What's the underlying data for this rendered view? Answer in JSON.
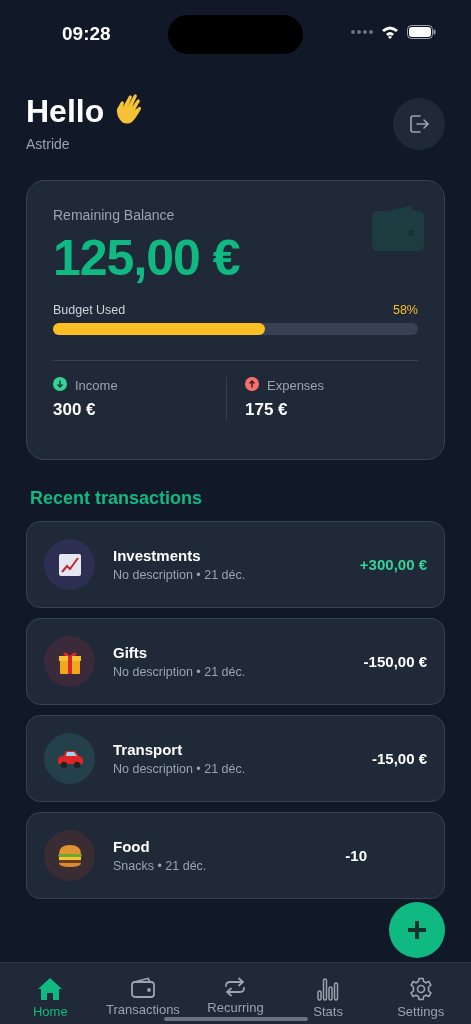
{
  "status_bar": {
    "time": "09:28"
  },
  "header": {
    "greeting": "Hello",
    "name": "Astride"
  },
  "balance": {
    "label": "Remaining Balance",
    "amount": "125,00 €",
    "budget_label": "Budget Used",
    "budget_percent": "58%",
    "level": 0.58,
    "stats": [
      {
        "kind": "income",
        "label": "Income",
        "value": "300 €"
      },
      {
        "kind": "expense",
        "label": "Expenses",
        "value": "175 €"
      }
    ]
  },
  "recent": {
    "title": "Recent transactions",
    "items": [
      {
        "kind": "investment",
        "name": "Investments",
        "detail": "No description • 21 déc.",
        "amount": "+300,00 €",
        "positive": true
      },
      {
        "kind": "gift",
        "name": "Gifts",
        "detail": "No description • 21 déc.",
        "amount": "-150,00 €",
        "positive": false
      },
      {
        "kind": "car",
        "name": "Transport",
        "detail": "No description • 21 déc.",
        "amount": "-15,00 €",
        "positive": false
      },
      {
        "kind": "food",
        "name": "Food",
        "detail": "Snacks • 21 déc.",
        "amount": "-10",
        "positive": false
      }
    ]
  },
  "tabs": [
    {
      "kind": "home",
      "label": "Home",
      "selected": true
    },
    {
      "kind": "wallet",
      "label": "Transactions",
      "selected": false
    },
    {
      "kind": "repeat",
      "label": "Recurring",
      "selected": false
    },
    {
      "kind": "stats",
      "label": "Stats",
      "selected": false
    },
    {
      "kind": "settings",
      "label": "Settings",
      "selected": false
    }
  ]
}
